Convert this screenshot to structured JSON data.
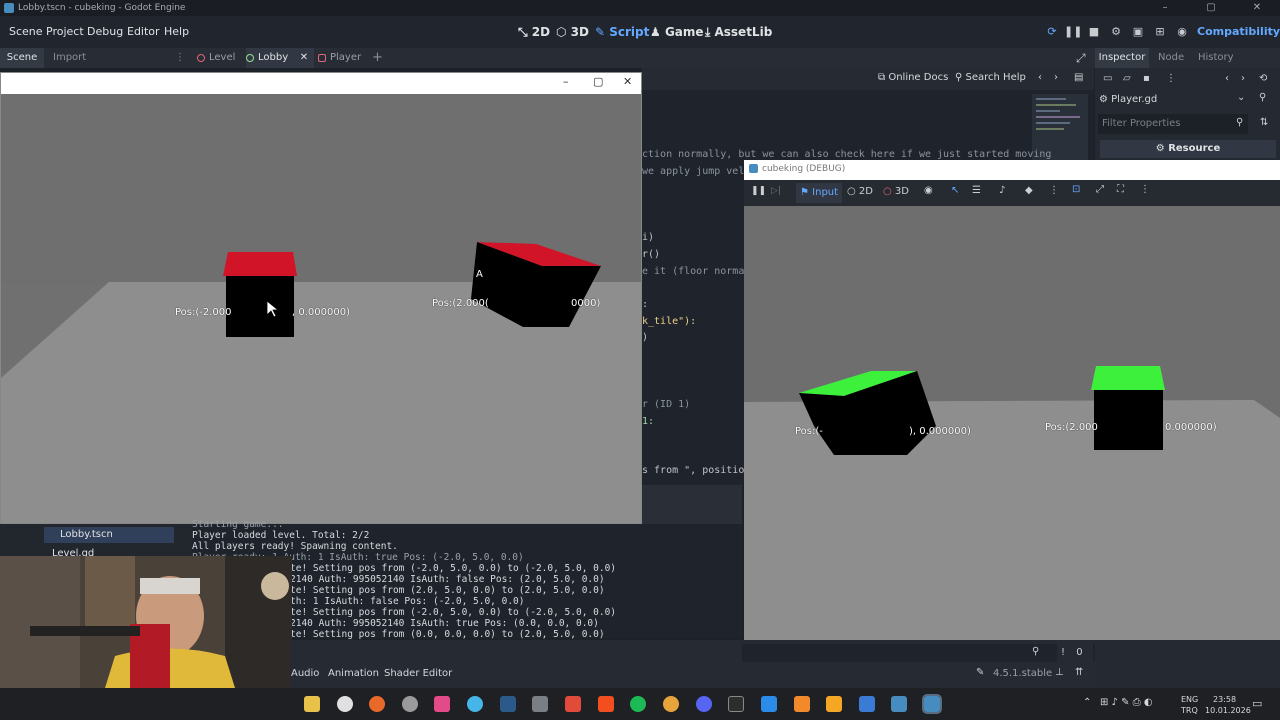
{
  "window": {
    "title": "Lobby.tscn - cubeking - Godot Engine",
    "controls": [
      "–",
      "▢",
      "✕"
    ]
  },
  "menu": {
    "items": [
      "Scene",
      "Project",
      "Debug",
      "Editor",
      "Help"
    ],
    "workspaces": [
      "2D",
      "3D",
      "Script",
      "Game",
      "AssetLib"
    ],
    "renderer": "Compatibility"
  },
  "dock": {
    "scene_tab": "Scene",
    "import_tab": "Import"
  },
  "scene_tabs": [
    "Level",
    "Lobby",
    "Player"
  ],
  "script_bar": {
    "online_docs": "Online Docs",
    "search_help": "Search Help"
  },
  "code": {
    "lines": [
      "ction normally, but we can also check here if we just started moving",
      "we apply jump velo",
      "i)",
      "r()",
      "e it (floor normal",
      ":",
      "k_tile\"):",
      ")",
      "r (ID 1)",
      " 1:",
      "s from \", position"
    ]
  },
  "inspector": {
    "tabs": [
      "Inspector",
      "Node",
      "History"
    ],
    "resource_name": "Player.gd",
    "filter_placeholder": "Filter Properties",
    "resource_button": "Resource"
  },
  "game_window": {
    "cubes": [
      {
        "label": "Pos:(-2.000",
        "label_right": ", 0.000000)",
        "top": "red"
      },
      {
        "label": "Pos:(2.000(",
        "label_right": "0000)",
        "top": "red",
        "letter": "A"
      }
    ]
  },
  "debug_window": {
    "title": "cubeking (DEBUG)",
    "toolbar": [
      "Input",
      "2D",
      "3D"
    ],
    "cubes": [
      {
        "label": "Pos:(-",
        "label_right": "), 0.000000)",
        "top": "green"
      },
      {
        "label": "Pos:(2.000",
        "label_right": "0.000000)",
        "top": "green"
      }
    ]
  },
  "filesystem": {
    "items": [
      "Lobby.tscn",
      "Level.gd"
    ]
  },
  "output": {
    "lines": [
      "Starting game...",
      "Player loaded level. Total: 2/2",
      "All players ready! Spawning content.",
      "Player ready: 1 Auth: 1 IsAuth: true Pos: (-2.0, 5.0, 0.0)",
      "te! Setting pos from (-2.0, 5.0, 0.0) to (-2.0, 5.0, 0.0)",
      "2140 Auth: 995052140 IsAuth: false Pos: (2.0, 5.0, 0.0)",
      "te! Setting pos from (2.0, 5.0, 0.0) to (2.0, 5.0, 0.0)",
      "th: 1 IsAuth: false Pos: (-2.0, 5.0, 0.0)",
      "te! Setting pos from (-2.0, 5.0, 0.0) to (-2.0, 5.0, 0.0)",
      "2140 Auth: 995052140 IsAuth: true Pos: (0.0, 0.0, 0.0)",
      "te! Setting pos from (0.0, 0.0, 0.0) to (2.0, 5.0, 0.0)"
    ],
    "counter": "0"
  },
  "bottom_tabs": [
    "Audio",
    "Animation",
    "Shader Editor"
  ],
  "version": "4.5.1.stable",
  "taskbar": {
    "lang_top": "ENG",
    "lang_bottom": "TRQ",
    "time": "23:58",
    "date": "10.01.2026"
  },
  "colors": {
    "accent": "#64a8ff",
    "red_top": "#d21428",
    "green_top": "#3cf03c",
    "floor": "#8e8e8e"
  }
}
